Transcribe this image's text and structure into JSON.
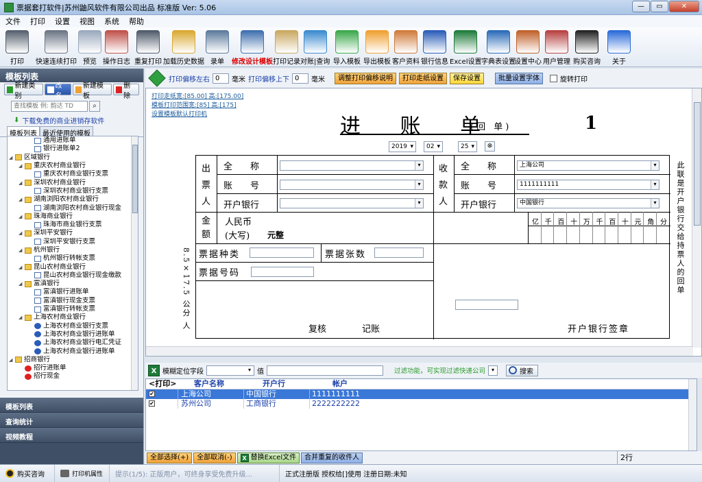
{
  "window": {
    "title": "票据套打软件|苏州鼬风软件有限公司出品 标准版  Ver: 5.06",
    "controls": {
      "minimize": "—",
      "maximize": "▭",
      "close": "✕"
    }
  },
  "menu": [
    "文件",
    "打印",
    "设置",
    "视图",
    "系统",
    "帮助"
  ],
  "toolbar": [
    {
      "label": "打印",
      "icon": "printer-icon",
      "color": "#555f6e"
    },
    {
      "label": "快速连续打印",
      "icon": "fast-print-icon",
      "color": "#6a7485"
    },
    {
      "label": "预览",
      "icon": "magnifier-icon",
      "color": "#9aa9bd"
    },
    {
      "label": "操作日志",
      "icon": "user-log-icon",
      "color": "#c0504a"
    },
    {
      "label": "重复打印",
      "icon": "repeat-print-icon",
      "color": "#4f5a6a"
    },
    {
      "label": "加载历史数据",
      "icon": "folder-history-icon",
      "color": "#d9a830"
    },
    {
      "label": "录单",
      "icon": "form-entry-icon",
      "color": "#5c7a9c"
    },
    {
      "label": "修改设计模板",
      "icon": "design-ruler-icon",
      "color": "#3e6fae",
      "highlight": true
    },
    {
      "label": "打印记录",
      "icon": "clipboard-icon",
      "color": "#c9a860"
    },
    {
      "label": "对账|查询",
      "icon": "pie-chart-icon",
      "color": "#3a8acf"
    },
    {
      "label": "导入模板",
      "icon": "import-arrow-icon",
      "color": "#3aa84a"
    },
    {
      "label": "导出模板",
      "icon": "export-arrow-icon",
      "color": "#f0a030"
    },
    {
      "label": "客户资料",
      "icon": "customers-icon",
      "color": "#d07a3a"
    },
    {
      "label": "银行信息",
      "icon": "bank-icon",
      "color": "#2a5cb8"
    },
    {
      "label": "Excel设置",
      "icon": "excel-icon",
      "color": "#1e7b3a"
    },
    {
      "label": "字典表设置",
      "icon": "dictionary-icon",
      "color": "#2a6ab8"
    },
    {
      "label": "设置中心",
      "icon": "tools-icon",
      "color": "#c0602a"
    },
    {
      "label": "用户管理",
      "icon": "user-manage-icon",
      "color": "#b84040"
    },
    {
      "label": "购买咨询",
      "icon": "qq-icon",
      "color": "#222222"
    },
    {
      "label": "关于",
      "icon": "info-icon",
      "color": "#2a6ad8"
    }
  ],
  "left": {
    "header": "模板列表",
    "buttons": [
      {
        "label": "新建类别",
        "icon": "new-category-icon"
      },
      {
        "label": "改名",
        "icon": "rename-icon"
      },
      {
        "label": "新建模板",
        "icon": "new-template-icon"
      },
      {
        "label": "删除",
        "icon": "delete-icon"
      }
    ],
    "search_placeholder": "查找模板 例: 韵达 TD",
    "download_link": "下载免费的商业进销存软件",
    "tabs": [
      "模板列表",
      "最近使用的模板"
    ],
    "tree": [
      {
        "label": "通用进账单",
        "level": 2,
        "type": "doc"
      },
      {
        "label": "银行进账单2",
        "level": 2,
        "type": "doc"
      },
      {
        "label": "区域银行",
        "level": 0,
        "type": "folder",
        "toggle": "◢"
      },
      {
        "label": "重庆农村商业银行",
        "level": 1,
        "type": "folder",
        "toggle": "◢"
      },
      {
        "label": "重庆农村商业银行支票",
        "level": 2,
        "type": "doc"
      },
      {
        "label": "深圳农村商业银行",
        "level": 1,
        "type": "folder",
        "toggle": "◢"
      },
      {
        "label": "深圳农村商业银行支票",
        "level": 2,
        "type": "doc"
      },
      {
        "label": "湖南浏阳农村商业银行",
        "level": 1,
        "type": "folder",
        "toggle": "◢"
      },
      {
        "label": "湖南浏阳农村商业银行现金",
        "level": 2,
        "type": "doc"
      },
      {
        "label": "珠海商业银行",
        "level": 1,
        "type": "folder",
        "toggle": "◢"
      },
      {
        "label": "珠海市商业银行支票",
        "level": 2,
        "type": "doc"
      },
      {
        "label": "深圳平安银行",
        "level": 1,
        "type": "folder",
        "toggle": "◢"
      },
      {
        "label": "深圳平安银行支票",
        "level": 2,
        "type": "doc"
      },
      {
        "label": "杭州银行",
        "level": 1,
        "type": "folder",
        "toggle": "◢"
      },
      {
        "label": "杭州银行转帐支票",
        "level": 2,
        "type": "doc"
      },
      {
        "label": "昆山农村商业银行",
        "level": 1,
        "type": "folder",
        "toggle": "◢"
      },
      {
        "label": "昆山农村商业银行现金缴款",
        "level": 2,
        "type": "doc"
      },
      {
        "label": "富滇银行",
        "level": 1,
        "type": "folder",
        "toggle": "◢"
      },
      {
        "label": "富滇银行进账单",
        "level": 2,
        "type": "doc"
      },
      {
        "label": "富滇银行现金支票",
        "level": 2,
        "type": "doc"
      },
      {
        "label": "富滇银行转帐支票",
        "level": 2,
        "type": "doc"
      },
      {
        "label": "上海农村商业银行",
        "level": 1,
        "type": "folder",
        "toggle": "◢"
      },
      {
        "label": "上海农村商业银行支票",
        "level": 2,
        "type": "bank"
      },
      {
        "label": "上海农村商业银行进账单",
        "level": 2,
        "type": "bank"
      },
      {
        "label": "上海农村商业银行电汇凭证",
        "level": 2,
        "type": "bank"
      },
      {
        "label": "上海农村商业银行进账单",
        "level": 2,
        "type": "bank"
      },
      {
        "label": "招商银行",
        "level": 0,
        "type": "folder",
        "toggle": "◢"
      },
      {
        "label": "招行进账单",
        "level": 1,
        "type": "cmb"
      },
      {
        "label": "招行现金",
        "level": 1,
        "type": "cmb"
      }
    ],
    "sections": [
      "模板列表",
      "查询统计",
      "视频教程"
    ]
  },
  "options": {
    "offset_lr_label": "打印偏移左右",
    "offset_lr_value": "0",
    "unit": "毫米",
    "offset_ud_label": "打印偏移上下",
    "offset_ud_value": "0",
    "btn_adjust": "调整打印偏移说明",
    "btn_paper": "打印走纸设置",
    "btn_save": "保存设置",
    "btn_font": "批量设置字体",
    "rotate_label": "旋转打印"
  },
  "canvas": {
    "links": [
      "打印走纸宽:[85.00] 高:[175.00]",
      "模板打印范围宽:[85] 高:[175]",
      "设置模板默认打印机"
    ],
    "title": "进 账 单",
    "subtitle": "(回    单)",
    "number": "1",
    "date": {
      "year": "2019",
      "month": "02",
      "day": "25",
      "cal_icon": "⊗"
    },
    "payer": {
      "group": [
        "出",
        "票",
        "人"
      ],
      "name_label": "全　　称",
      "account_label": "账　　号",
      "bank_label": "开户银行",
      "name": "",
      "account": "",
      "bank": ""
    },
    "payee": {
      "group": [
        "收",
        "款",
        "人"
      ],
      "name_label": "全　　称",
      "account_label": "账　　号",
      "bank_label": "开户银行",
      "name": "上海公司",
      "account": "1111111111",
      "bank": "中国银行"
    },
    "amount": {
      "group": [
        "金",
        "额"
      ],
      "rmb": "人民币",
      "upper": "(大写)",
      "upper_value": "元整",
      "digits": [
        "亿",
        "千",
        "百",
        "十",
        "万",
        "千",
        "百",
        "十",
        "元",
        "角",
        "分"
      ]
    },
    "bill_type_label": "票据种类",
    "bill_count_label": "票据张数",
    "bill_no_label": "票据号码",
    "review_label": "复核",
    "bookkeep_label": "记账",
    "bank_sign_label": "开户银行签章",
    "side_note": "此联是开户银行交给持票人的回单",
    "size_note": "8.5×17.5 公分 人"
  },
  "grid": {
    "locate_label": "模糊定位字段",
    "value_label": "值",
    "filter_tip": "过滤功能，可实现过滤快递公司",
    "search_label": "搜索",
    "columns": [
      "<打印>",
      "客户名称",
      "开户行",
      "帐户"
    ],
    "rows": [
      {
        "checked": true,
        "name": "上海公司",
        "bank": "中国银行",
        "account": "1111111111",
        "selected": true
      },
      {
        "checked": true,
        "name": "苏州公司",
        "bank": "工商银行",
        "account": "2222222222",
        "selected": false
      }
    ],
    "buttons": [
      "全部选择(+)",
      "全部取消(-)",
      "替换Excel文件",
      "合并重复的收件人"
    ],
    "row_count": "2行"
  },
  "status": {
    "buy": "购买咨询",
    "printer": "打印机属性",
    "tip": "提示(1/5): 正版用户，可终身享受免费升级...",
    "license": "正式注册版 授权给[]使用 注册日期:未知"
  }
}
